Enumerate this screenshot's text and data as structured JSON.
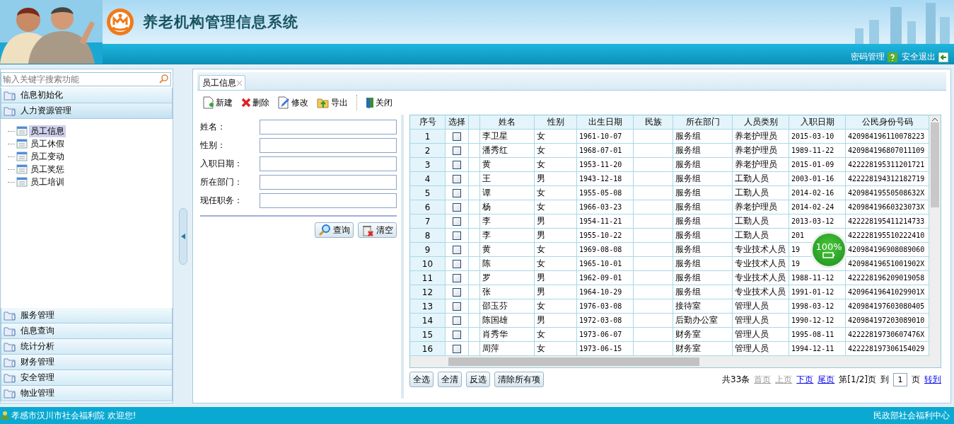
{
  "header": {
    "title": "养老机构管理信息系统",
    "links": [
      {
        "label": "密码管理",
        "kind": "help"
      },
      {
        "label": "安全退出",
        "kind": "exit"
      }
    ]
  },
  "sidebar": {
    "search_placeholder": "输入关键字搜索功能",
    "groups": [
      {
        "label": "信息初始化",
        "expanded": false
      },
      {
        "label": "人力资源管理",
        "expanded": true,
        "children": [
          {
            "label": "员工信息",
            "selected": true
          },
          {
            "label": "员工休假",
            "selected": false
          },
          {
            "label": "员工变动",
            "selected": false
          },
          {
            "label": "员工奖惩",
            "selected": false
          },
          {
            "label": "员工培训",
            "selected": false
          }
        ]
      },
      {
        "label": "服务管理",
        "expanded": false
      },
      {
        "label": "信息查询",
        "expanded": false
      },
      {
        "label": "统计分析",
        "expanded": false
      },
      {
        "label": "财务管理",
        "expanded": false
      },
      {
        "label": "安全管理",
        "expanded": false
      },
      {
        "label": "物业管理",
        "expanded": false
      }
    ]
  },
  "tabs": [
    {
      "label": "员工信息",
      "selected": true
    }
  ],
  "toolbar": [
    {
      "label": "新建",
      "kind": "new"
    },
    {
      "label": "删除",
      "kind": "delete"
    },
    {
      "label": "修改",
      "kind": "edit"
    },
    {
      "label": "导出",
      "kind": "export"
    },
    {
      "label": "关闭",
      "kind": "close"
    }
  ],
  "form": {
    "fields": [
      "姓名：",
      "性别：",
      "入职日期：",
      "所在部门：",
      "现任职务："
    ],
    "buttons": [
      {
        "label": "查询",
        "kind": "search"
      },
      {
        "label": "清空",
        "kind": "clear"
      }
    ]
  },
  "table": {
    "columns": [
      "序号",
      "选择",
      "姓名",
      "性别",
      "出生日期",
      "民族",
      "所在部门",
      "人员类别",
      "入职日期",
      "公民身份号码"
    ],
    "rows": [
      {
        "no": "1",
        "checked": false,
        "name": "李卫星",
        "sex": "女",
        "birth": "1961-10-07",
        "dept": "服务组",
        "category": "养老护理员",
        "joined": "2015-03-10",
        "id": "420984196110078223"
      },
      {
        "no": "2",
        "checked": false,
        "name": "潘秀红",
        "sex": "女",
        "birth": "1968-07-01",
        "dept": "服务组",
        "category": "养老护理员",
        "joined": "1989-11-22",
        "id": "420984196807011109"
      },
      {
        "no": "3",
        "checked": false,
        "name": "黄",
        "sex": "女",
        "birth": "1953-11-20",
        "dept": "服务组",
        "category": "养老护理员",
        "joined": "2015-01-09",
        "id": "422228195311201721"
      },
      {
        "no": "4",
        "checked": false,
        "name": "王",
        "sex": "男",
        "birth": "1943-12-18",
        "dept": "服务组",
        "category": "工勤人员",
        "joined": "2003-01-16",
        "id": "422228194312182719"
      },
      {
        "no": "5",
        "checked": false,
        "name": "谭",
        "sex": "女",
        "birth": "1955-05-08",
        "dept": "服务组",
        "category": "工勤人员",
        "joined": "2014-02-16",
        "id": "42098419550508632X"
      },
      {
        "no": "6",
        "checked": false,
        "name": "杨",
        "sex": "女",
        "birth": "1966-03-23",
        "dept": "服务组",
        "category": "养老护理员",
        "joined": "2014-02-24",
        "id": "42098419660323073X"
      },
      {
        "no": "7",
        "checked": false,
        "name": "李",
        "sex": "男",
        "birth": "1954-11-21",
        "dept": "服务组",
        "category": "工勤人员",
        "joined": "2013-03-12",
        "id": "422228195411214733"
      },
      {
        "no": "8",
        "checked": false,
        "name": "李",
        "sex": "男",
        "birth": "1955-10-22",
        "dept": "服务组",
        "category": "工勤人员",
        "joined": "201",
        "id": "422228195510222410"
      },
      {
        "no": "9",
        "checked": false,
        "name": "黄",
        "sex": "女",
        "birth": "1969-08-08",
        "dept": "服务组",
        "category": "专业技术人员",
        "joined": "19",
        "id": "420984196908089060"
      },
      {
        "no": "10",
        "checked": false,
        "name": "陈",
        "sex": "女",
        "birth": "1965-10-01",
        "dept": "服务组",
        "category": "专业技术人员",
        "joined": "19",
        "id": "42098419651001902X"
      },
      {
        "no": "11",
        "checked": false,
        "name": "罗",
        "sex": "男",
        "birth": "1962-09-01",
        "dept": "服务组",
        "category": "专业技术人员",
        "joined": "1988-11-12",
        "id": "422228196209019058"
      },
      {
        "no": "12",
        "checked": false,
        "name": "张",
        "sex": "男",
        "birth": "1964-10-29",
        "dept": "服务组",
        "category": "专业技术人员",
        "joined": "1991-01-12",
        "id": "42096419641029901X"
      },
      {
        "no": "13",
        "checked": false,
        "name": "邵玉芬",
        "sex": "女",
        "birth": "1976-03-08",
        "dept": "接待室",
        "category": "管理人员",
        "joined": "1998-03-12",
        "id": "420984197603080405"
      },
      {
        "no": "14",
        "checked": false,
        "name": "陈国雄",
        "sex": "男",
        "birth": "1972-03-08",
        "dept": "后勤办公室",
        "category": "管理人员",
        "joined": "1990-12-12",
        "id": "420984197203089010"
      },
      {
        "no": "15",
        "checked": false,
        "name": "肖秀华",
        "sex": "女",
        "birth": "1973-06-07",
        "dept": "财务室",
        "category": "管理人员",
        "joined": "1995-08-11",
        "id": "42222819730607476X"
      },
      {
        "no": "16",
        "checked": false,
        "name": "周萍",
        "sex": "女",
        "birth": "1973-06-15",
        "dept": "财务室",
        "category": "管理人员",
        "joined": "1994-12-11",
        "id": "422228197306154029"
      }
    ]
  },
  "table_buttons": [
    "全选",
    "全清",
    "反选",
    "清除所有项"
  ],
  "pager": {
    "total": "共33条",
    "links": [
      {
        "label": "首页",
        "disabled": true
      },
      {
        "label": "上页",
        "disabled": true
      },
      {
        "label": "下页",
        "disabled": false
      },
      {
        "label": "尾页",
        "disabled": false
      }
    ],
    "page": "第[1/2]页",
    "goto_label": "到",
    "goto_value": "1",
    "goto_unit": "页",
    "go": "转到"
  },
  "speed_ball": {
    "text": "100%"
  },
  "status_bar": {
    "left": "孝感市汉川市社会福利院 欢迎您!",
    "right": "民政部社会福利中心"
  }
}
